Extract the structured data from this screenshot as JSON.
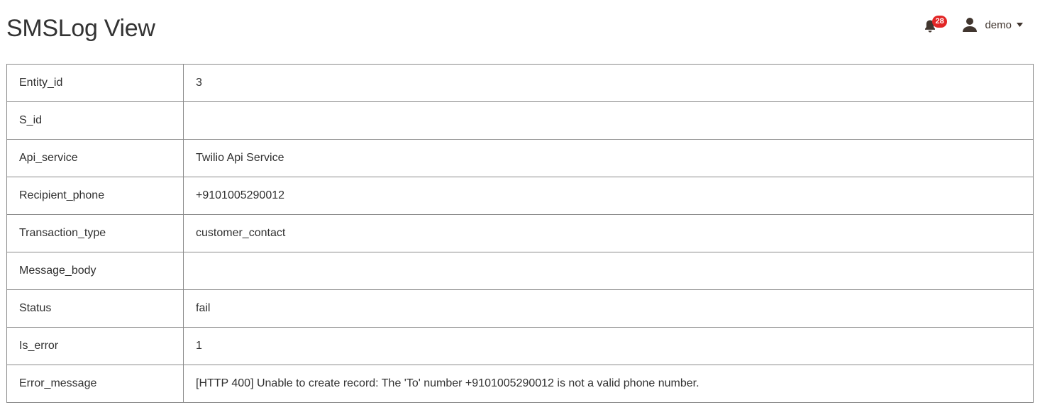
{
  "page": {
    "title": "SMSLog View"
  },
  "header": {
    "notifications": {
      "count": "28",
      "icon": "bell-icon",
      "badge_color": "#e22626"
    },
    "user": {
      "name": "demo",
      "icon": "user-icon",
      "menu_icon": "caret-down-icon"
    }
  },
  "details": {
    "rows": [
      {
        "label": "Entity_id",
        "value": "3"
      },
      {
        "label": "S_id",
        "value": ""
      },
      {
        "label": "Api_service",
        "value": "Twilio Api Service"
      },
      {
        "label": "Recipient_phone",
        "value": "+9101005290012"
      },
      {
        "label": "Transaction_type",
        "value": "customer_contact"
      },
      {
        "label": "Message_body",
        "value": ""
      },
      {
        "label": "Status",
        "value": "fail"
      },
      {
        "label": "Is_error",
        "value": "1"
      },
      {
        "label": "Error_message",
        "value": "[HTTP 400] Unable to create record: The 'To' number +9101005290012 is not a valid phone number."
      }
    ]
  },
  "colors": {
    "border": "#8a8a8a",
    "text": "#303030"
  }
}
